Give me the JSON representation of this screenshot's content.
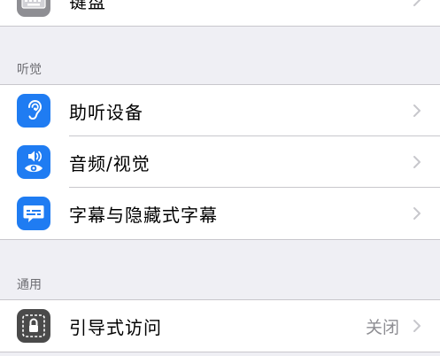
{
  "colors": {
    "background": "#efeff4",
    "cell": "#ffffff",
    "separator": "#c8c7cc",
    "icon_blue": "#1f7cf2",
    "icon_gray": "#8e8e93",
    "icon_dark": "#4a4a4a",
    "header_text": "#6d6d72",
    "value_text": "#8e8e93",
    "chevron": "#c7c7cc"
  },
  "group_top": {
    "rows": [
      {
        "label": "键盘",
        "icon": "keyboard-icon"
      }
    ]
  },
  "section_hearing": {
    "header": "听觉",
    "rows": [
      {
        "label": "助听设备",
        "icon": "ear-icon"
      },
      {
        "label": "音频/视觉",
        "icon": "speaker-eye-icon"
      },
      {
        "label": "字幕与隐藏式字幕",
        "icon": "caption-bubble-icon"
      }
    ]
  },
  "section_general": {
    "header": "通用",
    "rows": [
      {
        "label": "引导式访问",
        "value": "关闭",
        "icon": "lock-icon"
      }
    ]
  }
}
